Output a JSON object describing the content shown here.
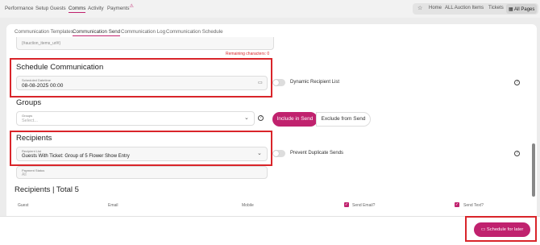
{
  "topnav": {
    "items": [
      "Performance",
      "Setup",
      "Guests",
      "Comms",
      "Activity",
      "Payments"
    ],
    "active": "Comms",
    "alert_icon": "warning-icon"
  },
  "tools": {
    "star_icon": "star-icon",
    "home": "Home",
    "auction": "ALL Auction Items",
    "tickets": "Tickets",
    "all_pages": "All Pages",
    "grid_icon": "grid-icon"
  },
  "subtabs": {
    "items": [
      "Communication Templates",
      "Communication Send",
      "Communication Log",
      "Communication Schedule"
    ],
    "active": "Communication Send"
  },
  "message": {
    "text": "{#auction_items_url#}",
    "remaining": "Remaining characters: 0"
  },
  "schedule": {
    "title": "Schedule Communication",
    "date_label": "Scheduled Datetime",
    "date_value": "08-08-2025 00:00",
    "dynamic_label": "Dynamic Recipient List"
  },
  "groups": {
    "title": "Groups",
    "field_label": "Groups",
    "placeholder": "Select...",
    "include": "Include in Send",
    "exclude": "Exclude from Send"
  },
  "recipients": {
    "title": "Recipients",
    "list_label": "Recipient List",
    "list_value": "Guests With Ticket: Group of 5 Flower Show Entry",
    "dup_label": "Prevent Duplicate Sends",
    "payment_label": "Payment Status",
    "payment_value": "All"
  },
  "table": {
    "title": "Recipients | Total 5",
    "headers": [
      "Guest",
      "Email",
      "Mobile",
      "Send Email?",
      "Send Text?"
    ]
  },
  "footer": {
    "schedule_button": "Schedule for later"
  },
  "colors": {
    "accent": "#c0226e",
    "highlight": "#d9252a"
  }
}
